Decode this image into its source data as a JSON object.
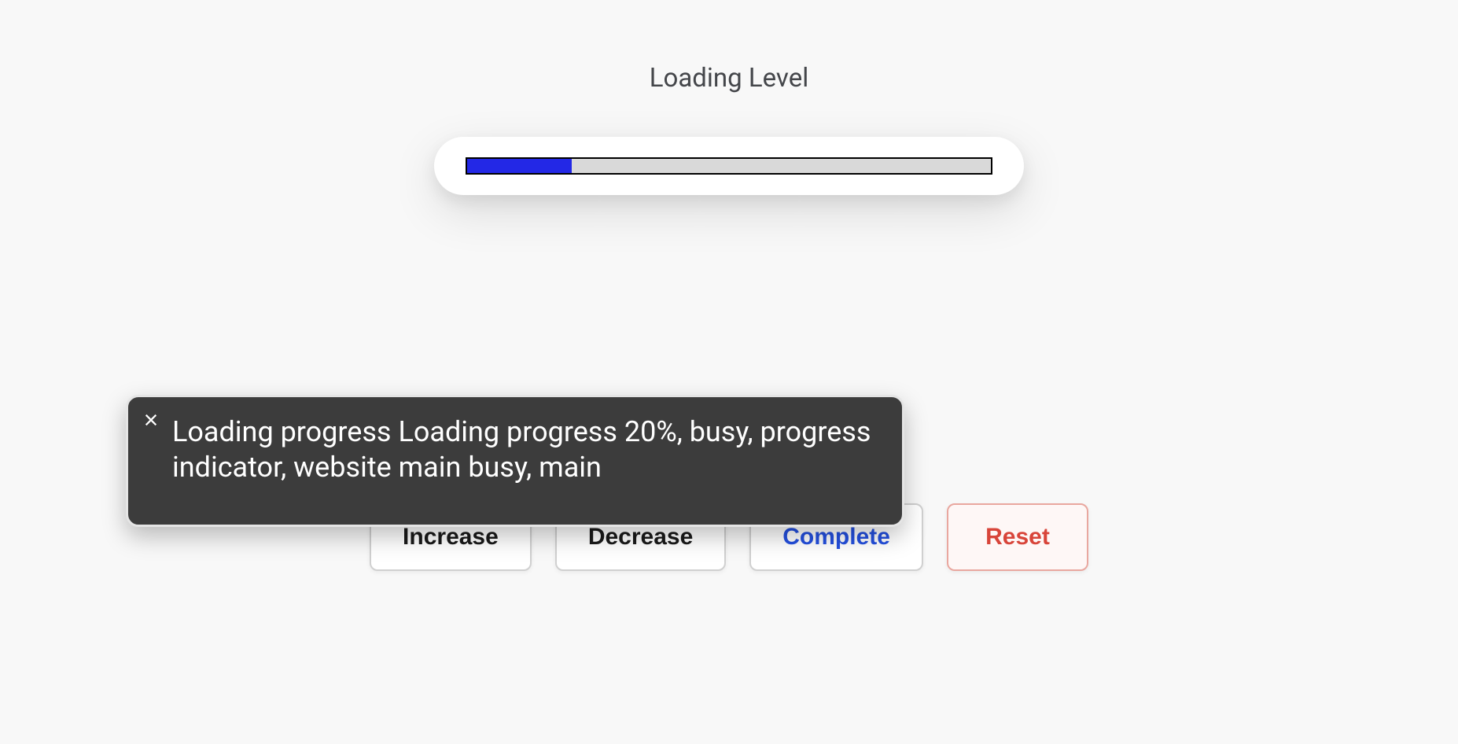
{
  "title": "Loading Level",
  "progress": {
    "percent": 20
  },
  "tooltip": {
    "text": "Loading progress Loading progress 20%, busy, progress indicator, website main busy, main"
  },
  "buttons": {
    "increase": "Increase",
    "decrease": "Decrease",
    "complete": "Complete",
    "reset": "Reset"
  }
}
